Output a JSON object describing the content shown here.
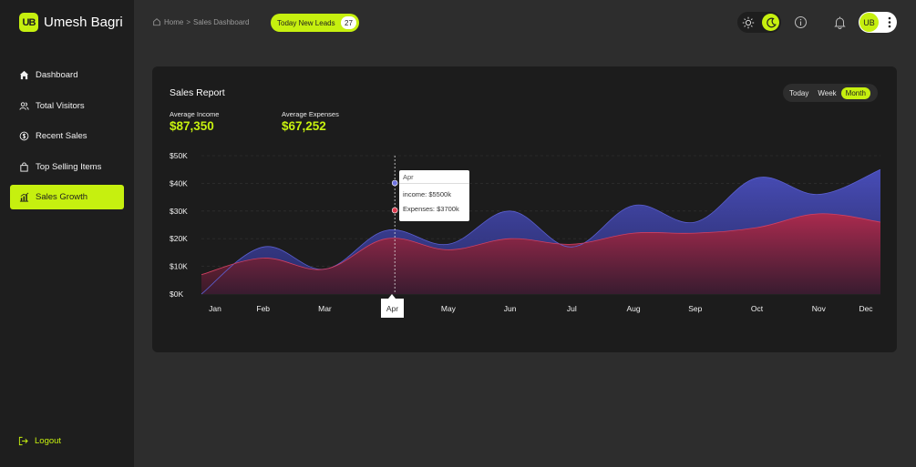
{
  "brand": {
    "logo_text": "UB",
    "name": "Umesh Bagri"
  },
  "nav": [
    {
      "label": "Dashboard",
      "icon": "home-icon"
    },
    {
      "label": "Total Visitors",
      "icon": "users-icon"
    },
    {
      "label": "Recent Sales",
      "icon": "dollar-icon"
    },
    {
      "label": "Top Selling Items",
      "icon": "bag-icon"
    },
    {
      "label": "Sales Growth",
      "icon": "bar-chart-icon",
      "active": true
    }
  ],
  "logout_label": "Logout",
  "breadcrumb": {
    "home": "Home",
    "separator": ">",
    "current": "Sales Dashboard"
  },
  "leads": {
    "label": "Today New Leads",
    "count": "27"
  },
  "avatar": {
    "initials": "UB"
  },
  "card": {
    "title": "Sales Report",
    "ranges": [
      "Today",
      "Week",
      "Month"
    ],
    "active_range": "Month",
    "avg_income_label": "Average Income",
    "avg_income_value": "$87,350",
    "avg_expenses_label": "Average Expenses",
    "avg_expenses_value": "$67,252"
  },
  "tooltip": {
    "month": "Apr",
    "income": "income: $5500k",
    "expenses": "Expenses: $3700k"
  },
  "colors": {
    "accent": "#c6f00f",
    "income": "#4a4fbf",
    "expenses": "#b0294a"
  },
  "chart_data": {
    "type": "area",
    "categories": [
      "Jan",
      "Feb",
      "Mar",
      "Apr",
      "May",
      "Jun",
      "Jul",
      "Aug",
      "Sep",
      "Oct",
      "Nov",
      "Dec"
    ],
    "y_ticks": [
      "$0K",
      "$10K",
      "$20K",
      "$30K",
      "$40K",
      "$50K"
    ],
    "ylim": [
      0,
      50000
    ],
    "active_category": "Apr",
    "series": [
      {
        "values": [
          0,
          17000,
          9000,
          23000,
          18000,
          30000,
          17000,
          32000,
          26000,
          42000,
          36000,
          45000
        ]
      },
      {
        "values": [
          7000,
          13000,
          9000,
          20000,
          16000,
          20000,
          18000,
          22000,
          22000,
          24000,
          29000,
          26000
        ]
      }
    ]
  }
}
